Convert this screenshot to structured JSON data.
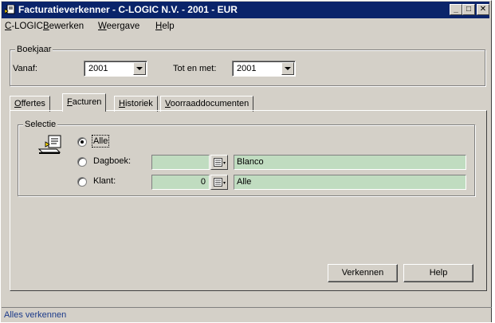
{
  "window": {
    "title": "Facturatieverkenner - C-LOGIC N.V. - 2001 - EUR",
    "controls": {
      "minimize": "_",
      "maximize": "□",
      "close": "✕"
    }
  },
  "menu": [
    {
      "pre": "",
      "u": "C",
      "post": "-LOGIC"
    },
    {
      "pre": "",
      "u": "B",
      "post": "ewerken"
    },
    {
      "pre": "",
      "u": "W",
      "post": "eergave"
    },
    {
      "pre": "",
      "u": "H",
      "post": "elp"
    }
  ],
  "boekjaar": {
    "legend": "Boekjaar",
    "vanaf_label": "Vanaf:",
    "vanaf_value": "2001",
    "tot_label": "Tot en met:",
    "tot_value": "2001"
  },
  "tabs": [
    {
      "pre": "",
      "u": "O",
      "post": "ffertes",
      "active": false
    },
    {
      "pre": "",
      "u": "F",
      "post": "acturen",
      "active": true
    },
    {
      "pre": "",
      "u": "H",
      "post": "istoriek",
      "active": false
    },
    {
      "pre": "",
      "u": "V",
      "post": "oorraaddocumenten",
      "active": false
    }
  ],
  "selectie": {
    "legend": "Selectie",
    "options": [
      {
        "label": "Alle",
        "checked": true
      },
      {
        "label": "Dagboek:",
        "checked": false,
        "code": "",
        "desc": "Blanco"
      },
      {
        "label": "Klant:",
        "checked": false,
        "code": "0",
        "desc": "Alle"
      }
    ]
  },
  "buttons": {
    "verkennen": "Verkennen",
    "help": "Help"
  },
  "status": {
    "text": "Alles verkennen"
  },
  "colors": {
    "titlebar": "#0a246a",
    "face": "#d4d0c8",
    "field_green": "#c0dcc0",
    "status_text": "#1b3a8a"
  }
}
